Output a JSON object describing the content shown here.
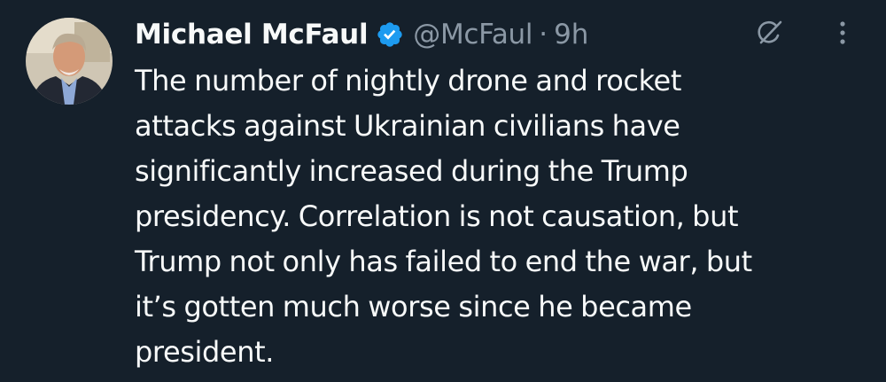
{
  "tweet": {
    "author": {
      "display_name": "Michael McFaul",
      "handle": "@McFaul",
      "verified": true,
      "avatar_icon": "author-avatar-photo"
    },
    "separator": "·",
    "timestamp": "9h",
    "actions": {
      "grok_icon": "grok-icon",
      "more_icon": "more-options-icon"
    },
    "text_lines": [
      "The number of nightly drone and rocket",
      "attacks against Ukrainian civilians have",
      "significantly increased during the Trump",
      "presidency. Correlation is not causation, but",
      "Trump not only has failed to end the war, but",
      "it’s gotten much worse since he became",
      "president."
    ]
  },
  "colors": {
    "background": "#15202b",
    "primary_text": "#f7f9f9",
    "secondary_text": "#8b98a5",
    "verified_blue": "#1d9bf0"
  }
}
